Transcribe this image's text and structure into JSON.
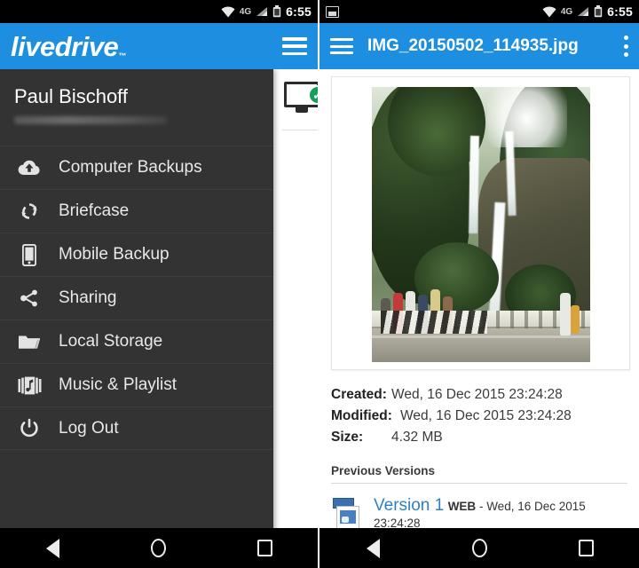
{
  "left": {
    "statusbar": {
      "network": "4G",
      "time": "6:55",
      "icons": [
        "wifi-icon",
        "signal-icon",
        "battery-icon"
      ]
    },
    "appbar": {
      "logo_text": "livedrive",
      "trademark": "™",
      "menu_icon": "hamburger-icon",
      "background": "#1e8fe0"
    },
    "drawer": {
      "user_name": "Paul Bischoff",
      "user_email_redacted": true,
      "items": [
        {
          "label": "Computer Backups",
          "icon": "cloud-upload-icon"
        },
        {
          "label": "Briefcase",
          "icon": "sync-refresh-icon"
        },
        {
          "label": "Mobile Backup",
          "icon": "phone-icon"
        },
        {
          "label": "Sharing",
          "icon": "share-icon"
        },
        {
          "label": "Local Storage",
          "icon": "folder-icon"
        },
        {
          "label": "Music & Playlist",
          "icon": "music-icon"
        },
        {
          "label": "Log Out",
          "icon": "power-icon"
        }
      ]
    },
    "behind": {
      "chip_icon": "computer-backup-status-icon",
      "status": "check-ok",
      "status_color": "#14a05a"
    }
  },
  "right": {
    "statusbar": {
      "notification_icon": "photo-icon",
      "network": "4G",
      "time": "6:55",
      "icons": [
        "wifi-icon",
        "signal-icon",
        "battery-icon"
      ]
    },
    "appbar": {
      "menu_icon": "hamburger-icon",
      "title": "IMG_20150502_114935.jpg",
      "overflow_icon": "kebab-menu-icon",
      "background": "#1e8fe0"
    },
    "photo": {
      "alt": "waterfall-photo-thumbnail"
    },
    "meta": [
      {
        "key": "Created:",
        "value": "Wed, 16 Dec 2015 23:24:28"
      },
      {
        "key": "Modified:",
        "value": "Wed, 16 Dec 2015 23:24:28"
      },
      {
        "key": "Size:",
        "value": "4.32 MB"
      }
    ],
    "versions_heading": "Previous Versions",
    "versions": [
      {
        "title": "Version 1",
        "source": "WEB",
        "separator": " - ",
        "date": "Wed, 16 Dec 2015 23:24:28",
        "icon": "image-version-icon",
        "link_color": "#2f7fc4"
      }
    ]
  },
  "navbar": {
    "back": "back-icon",
    "home": "home-icon",
    "recents": "recents-icon"
  }
}
